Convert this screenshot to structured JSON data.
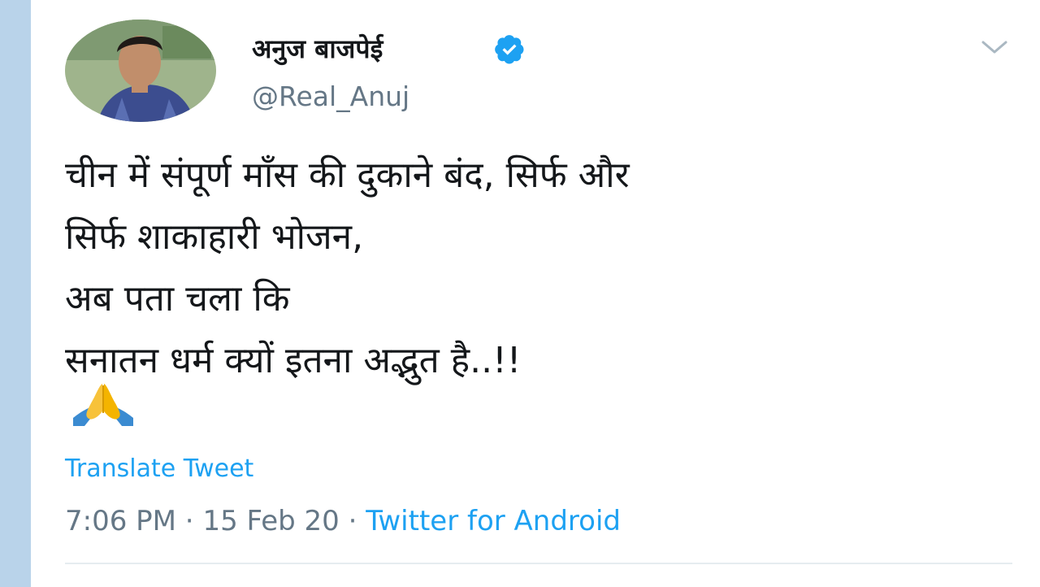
{
  "user": {
    "display_name": "अनुज बाजपेई",
    "handle": "@Real_Anuj",
    "verified": true
  },
  "tweet": {
    "lines": [
      "चीन में संपूर्ण माँस की दुकाने बंद, सिर्फ और",
      "सिर्फ शाकाहारी भोजन,",
      "अब पता चला कि",
      "सनातन धर्म क्यों इतना अद्भुत है..!!"
    ],
    "emoji": "🙏",
    "translate_label": "Translate Tweet"
  },
  "meta": {
    "time": "7:06 PM",
    "separator": " · ",
    "date": "15 Feb 20",
    "source": "Twitter for Android"
  },
  "colors": {
    "link": "#1da1f2",
    "text": "#14171a",
    "muted": "#657786",
    "left_bar": "#b9d3ea"
  },
  "icons": {
    "verified": "verified-badge-icon",
    "menu": "chevron-down-icon"
  }
}
